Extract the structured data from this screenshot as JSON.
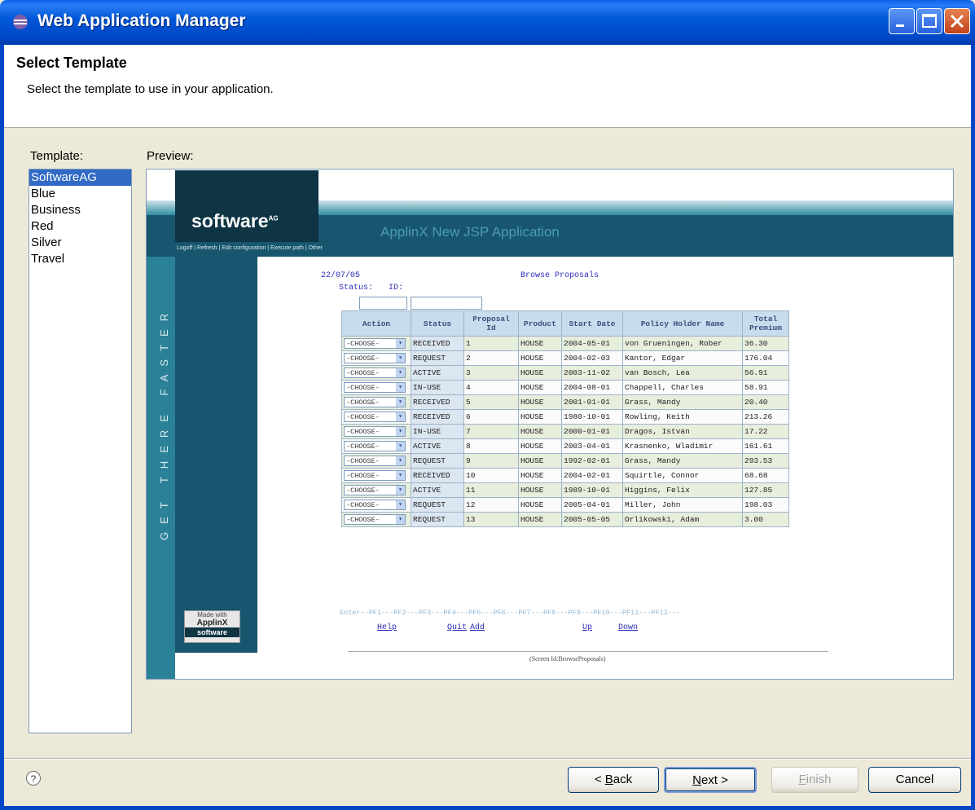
{
  "window": {
    "title": "Web Application Manager",
    "colors": {
      "titlebar": "#0047c7",
      "selection": "#316ac5"
    }
  },
  "header": {
    "title": "Select Template",
    "subtitle": "Select the template to use in your application."
  },
  "template_label": "Template:",
  "preview_label": "Preview:",
  "templates": [
    "SoftwareAG",
    "Blue",
    "Business",
    "Red",
    "Silver",
    "Travel"
  ],
  "selected_template": "SoftwareAG",
  "preview": {
    "logo": "software",
    "logo_sup": "AG",
    "app_name": "ApplinX New JSP Application",
    "nav": "Logoff | Refresh | Edit configuration | Execute path | Other",
    "side_tagline": "GET THERE FASTER",
    "made_with": {
      "line1": "Made with",
      "line2": "ApplinX",
      "line3": "software"
    },
    "date": "22/07/05",
    "screen_title": "Browse Proposals",
    "status_label": "Status:",
    "id_label": "ID:",
    "table": {
      "headers": [
        "Action",
        "Status",
        "Proposal Id",
        "Product",
        "Start Date",
        "Policy Holder Name",
        "Total Premium"
      ],
      "choose_label": "-CHOOSE-",
      "rows": [
        [
          "RECEIVED",
          "1",
          "HOUSE",
          "2004-05-01",
          "von Grueningen, Rober",
          "36.30"
        ],
        [
          "REQUEST",
          "2",
          "HOUSE",
          "2004-02-03",
          "Kantor, Edgar",
          "176.04"
        ],
        [
          "ACTIVE",
          "3",
          "HOUSE",
          "2003-11-02",
          "van Bosch, Lea",
          "56.91"
        ],
        [
          "IN-USE",
          "4",
          "HOUSE",
          "2004-08-01",
          "Chappell, Charles",
          "58.91"
        ],
        [
          "RECEIVED",
          "5",
          "HOUSE",
          "2001-01-01",
          "Grass, Mandy",
          "20.40"
        ],
        [
          "RECEIVED",
          "6",
          "HOUSE",
          "1980-10-01",
          "Rowling, Keith",
          "213.26"
        ],
        [
          "IN-USE",
          "7",
          "HOUSE",
          "2000-01-01",
          "Dragos, Istvan",
          "17.22"
        ],
        [
          "ACTIVE",
          "8",
          "HOUSE",
          "2003-04-01",
          "Krasnenko, Wladimir",
          "161.61"
        ],
        [
          "REQUEST",
          "9",
          "HOUSE",
          "1992-02-01",
          "Grass, Mandy",
          "293.53"
        ],
        [
          "RECEIVED",
          "10",
          "HOUSE",
          "2004-02-01",
          "Squirtle, Connor",
          "68.68"
        ],
        [
          "ACTIVE",
          "11",
          "HOUSE",
          "1989-10-01",
          "Higgins, Felix",
          "127.85"
        ],
        [
          "REQUEST",
          "12",
          "HOUSE",
          "2005-04-01",
          "Miller, John",
          "198.03"
        ],
        [
          "REQUEST",
          "13",
          "HOUSE",
          "2005-05-05",
          "Orlikowski, Adam",
          "3.00"
        ]
      ]
    },
    "fkeys": "Enter--PF1---PF2---PF3---PF4---PF5---PF6---PF7---PF8---PF9---PF10---PF11---PF12---",
    "fkey_links": [
      "Help",
      "Quit",
      "Add",
      "Up",
      "Down"
    ],
    "screen_id": "(Screen Id:BrowseProposals)"
  },
  "buttons": {
    "back": "< Back",
    "next": "Next >",
    "finish": "Finish",
    "cancel": "Cancel"
  },
  "help_icon": "question-circle-icon"
}
